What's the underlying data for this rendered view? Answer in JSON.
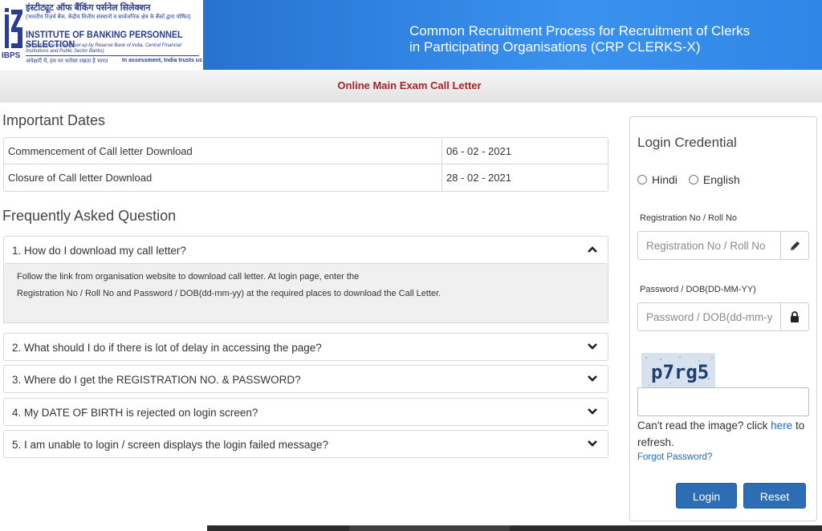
{
  "header": {
    "logo": {
      "hindi_name": "इंस्टीट्यूट ऑफ बैंकिंग पर्सनेल सिलेक्शन",
      "hindi_sub": "(भारतीय रिज़र्व बैंक, केंद्रीय वित्तीय संस्थानों व सार्वजनिक क्षेत्र के बैंकों द्वारा पोषित)",
      "english_name": "INSTITUTE OF BANKING PERSONNEL SELECTION",
      "english_sub": "(An autonomous body set up by Reserve Bank of India, Central Financial Institutions and Public Sector Banks)",
      "motto_hindi": "अपेक्षाएँ में, हम पर भरोसा रखता है भारत",
      "motto_english": "In assessment, India trusts us",
      "abbr": "IBPS"
    },
    "title": "Common Recruitment Process for Recruitment of Clerks in Participating Organisations (CRP CLERKS-X)"
  },
  "subheader": {
    "title": "Online Main Exam Call Letter"
  },
  "important_dates": {
    "title": "Important Dates",
    "rows": [
      {
        "label": "Commencement of Call letter Download",
        "value": "06 - 02 - 2021"
      },
      {
        "label": "Closure of Call letter Download",
        "value": "28 - 02 - 2021"
      }
    ]
  },
  "faq": {
    "title": "Frequently Asked Question",
    "items": [
      {
        "question": "1. How do I download my call letter?",
        "expanded": true,
        "answer_line1": "Follow the link from organisation website to download call letter. At login page, enter the",
        "answer_line2": "Registration No / Roll No and Password / DOB(dd-mm-yy) at the required places to download the Call Letter."
      },
      {
        "question": "2. What should I do if there is lot of delay in accessing the page?",
        "expanded": false
      },
      {
        "question": "3. Where do I get the REGISTRATION NO. & PASSWORD?",
        "expanded": false
      },
      {
        "question": "4. My DATE OF BIRTH is rejected on login screen?",
        "expanded": false
      },
      {
        "question": "5. I am unable to login / screen displays the login failed message?",
        "expanded": false
      }
    ]
  },
  "login": {
    "title": "Login Credential",
    "language_options": [
      "Hindi",
      "English"
    ],
    "registration": {
      "label": "Registration No / Roll No",
      "placeholder": "Registration No / Roll No",
      "value": "",
      "icon": "pencil-icon"
    },
    "password": {
      "label": "Password / DOB(DD-MM-YY)",
      "placeholder": "Password / DOB(dd-mm-yy)",
      "value": "",
      "icon": "lock-icon"
    },
    "captcha": {
      "text": "p7rg5",
      "input_value": ""
    },
    "refresh_prefix": "Can't read the image? click ",
    "refresh_link": "here",
    "refresh_suffix": " to refresh.",
    "forgot_password": "Forgot Password?",
    "login_button": "Login",
    "reset_button": "Reset"
  },
  "colors": {
    "header_blue": "#2a7ad8",
    "subheader_title": "#a32626",
    "button_blue": "#2c6db3",
    "link_blue": "#1b6ac0"
  }
}
